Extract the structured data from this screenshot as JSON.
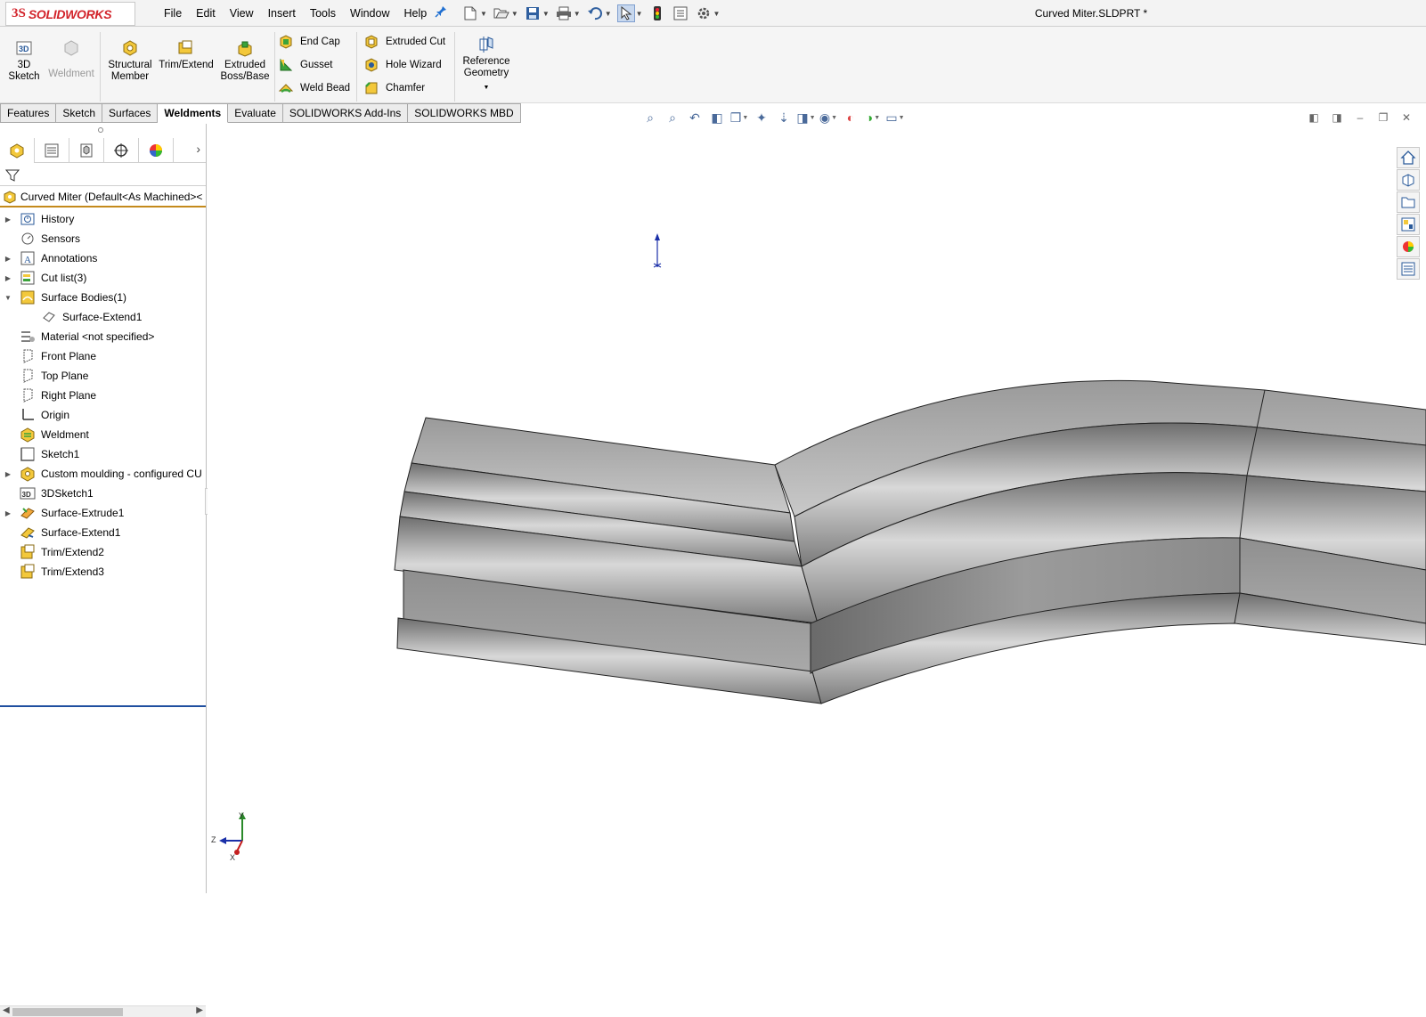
{
  "app": {
    "brand_prefix": "3S",
    "brand_name": "SOLIDWORKS",
    "document_title": "Curved Miter.SLDPRT *"
  },
  "menu": [
    "File",
    "Edit",
    "View",
    "Insert",
    "Tools",
    "Window",
    "Help"
  ],
  "quick_access": [
    "new-icon",
    "open-icon",
    "save-icon",
    "print-icon",
    "undo-icon",
    "select-icon",
    "rebuild-icon",
    "file-properties-icon",
    "options-icon"
  ],
  "command_manager": {
    "sketch3d": "3D\nSketch",
    "weldment": "Weldment",
    "structural_member": "Structural\nMember",
    "trim_extend": "Trim/Extend",
    "extruded_boss": "Extruded\nBoss/Base",
    "end_cap": "End Cap",
    "gusset": "Gusset",
    "weld_bead": "Weld Bead",
    "extruded_cut": "Extruded Cut",
    "hole_wizard": "Hole Wizard",
    "chamfer": "Chamfer",
    "reference_geometry": "Reference\nGeometry"
  },
  "tabs": [
    {
      "label": "Features",
      "active": false
    },
    {
      "label": "Sketch",
      "active": false
    },
    {
      "label": "Surfaces",
      "active": false
    },
    {
      "label": "Weldments",
      "active": true
    },
    {
      "label": "Evaluate",
      "active": false
    },
    {
      "label": "SOLIDWORKS Add-Ins",
      "active": false
    },
    {
      "label": "SOLIDWORKS MBD",
      "active": false
    }
  ],
  "tree": {
    "root": "Curved Miter  (Default<As Machined><",
    "items": [
      {
        "label": "History",
        "icon": "history-icon",
        "expand": "closed",
        "child": false
      },
      {
        "label": "Sensors",
        "icon": "sensors-icon",
        "expand": "",
        "child": false
      },
      {
        "label": "Annotations",
        "icon": "annotations-icon",
        "expand": "closed",
        "child": false
      },
      {
        "label": "Cut list(3)",
        "icon": "cut-list-icon",
        "expand": "closed",
        "child": false
      },
      {
        "label": "Surface Bodies(1)",
        "icon": "surface-bodies-icon",
        "expand": "open",
        "child": false
      },
      {
        "label": "Surface-Extend1",
        "icon": "surface-body-icon",
        "expand": "",
        "child": true
      },
      {
        "label": "Material <not specified>",
        "icon": "material-icon",
        "expand": "",
        "child": false
      },
      {
        "label": "Front Plane",
        "icon": "plane-icon",
        "expand": "",
        "child": false
      },
      {
        "label": "Top Plane",
        "icon": "plane-icon",
        "expand": "",
        "child": false
      },
      {
        "label": "Right Plane",
        "icon": "plane-icon",
        "expand": "",
        "child": false
      },
      {
        "label": "Origin",
        "icon": "origin-icon",
        "expand": "",
        "child": false
      },
      {
        "label": "Weldment",
        "icon": "weldment-icon",
        "expand": "",
        "child": false
      },
      {
        "label": "Sketch1",
        "icon": "sketch-icon",
        "expand": "",
        "child": false
      },
      {
        "label": "Custom moulding - configured CU",
        "icon": "structural-member-icon",
        "expand": "closed",
        "child": false
      },
      {
        "label": "3DSketch1",
        "icon": "sketch3d-icon",
        "expand": "",
        "child": false
      },
      {
        "label": "Surface-Extrude1",
        "icon": "surface-extrude-icon",
        "expand": "closed",
        "child": false
      },
      {
        "label": "Surface-Extend1",
        "icon": "surface-extend-icon",
        "expand": "",
        "child": false
      },
      {
        "label": "Trim/Extend2",
        "icon": "trim-extend-icon",
        "expand": "",
        "child": false
      },
      {
        "label": "Trim/Extend3",
        "icon": "trim-extend-icon",
        "expand": "",
        "child": false
      }
    ]
  },
  "triad": {
    "y": "Y",
    "z": "Z",
    "x": "X"
  },
  "colors": {
    "brand": "#d2232a",
    "active_tab": "#ffffff",
    "rollback": "#1f4f9f",
    "model_gray": "#a8a8a8"
  }
}
